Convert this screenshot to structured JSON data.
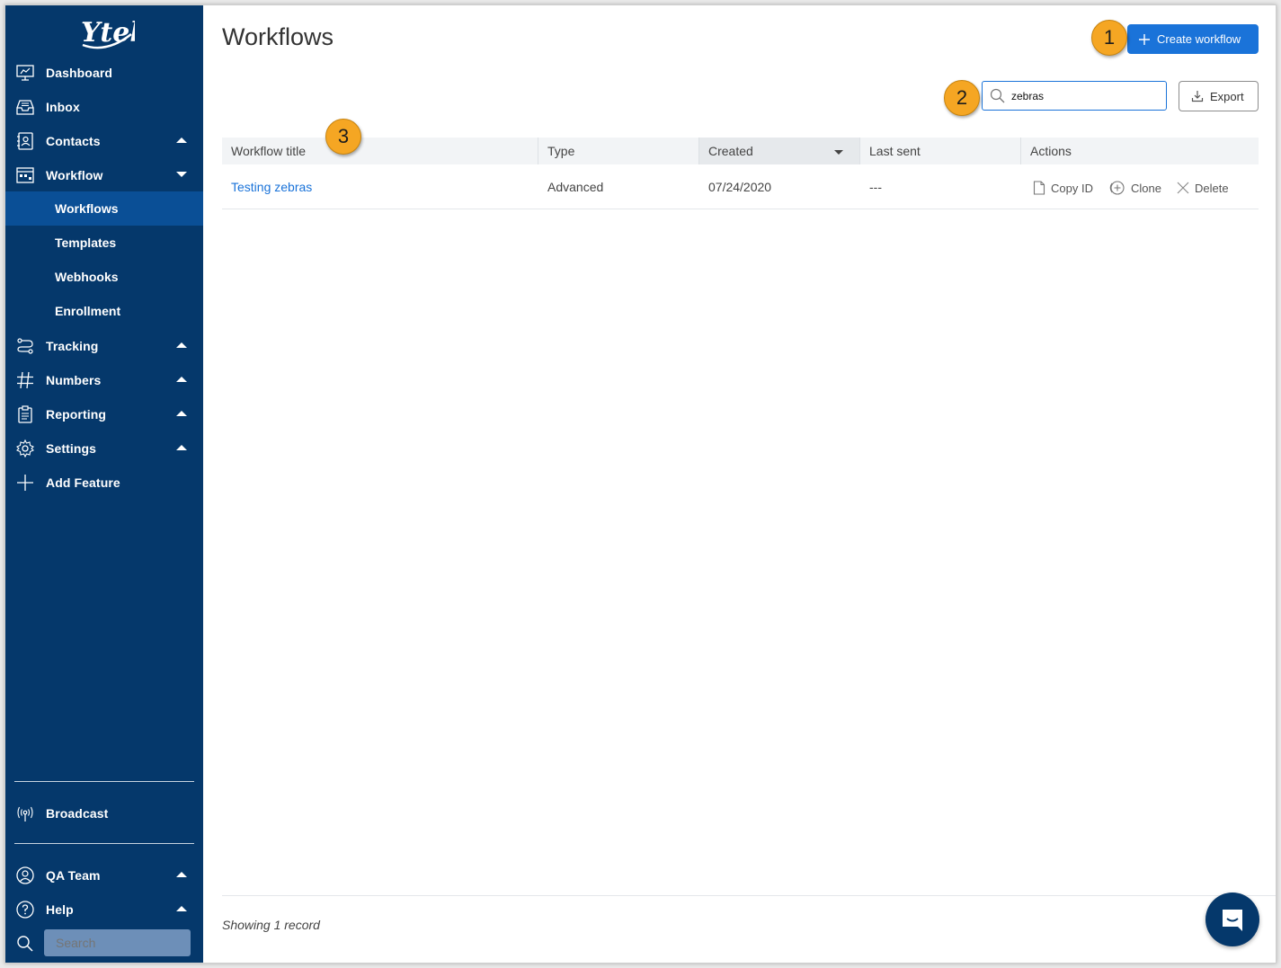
{
  "sidebar": {
    "logo_text": "Ytel",
    "items": [
      {
        "label": "Dashboard"
      },
      {
        "label": "Inbox"
      },
      {
        "label": "Contacts"
      },
      {
        "label": "Workflow"
      },
      {
        "label": "Tracking"
      },
      {
        "label": "Numbers"
      },
      {
        "label": "Reporting"
      },
      {
        "label": "Settings"
      },
      {
        "label": "Add Feature"
      }
    ],
    "workflow_sub": [
      {
        "label": "Workflows"
      },
      {
        "label": "Templates"
      },
      {
        "label": "Webhooks"
      },
      {
        "label": "Enrollment"
      }
    ],
    "broadcast": "Broadcast",
    "team": "QA Team",
    "help": "Help",
    "search_placeholder": "Search"
  },
  "header": {
    "title": "Workflows",
    "create_label": "Create workflow",
    "export_label": "Export",
    "search_value": "zebras"
  },
  "badges": [
    "1",
    "2",
    "3"
  ],
  "table": {
    "columns": [
      "Workflow title",
      "Type",
      "Created",
      "Last sent",
      "Actions"
    ],
    "rows": [
      {
        "title": "Testing zebras",
        "type": "Advanced",
        "created": "07/24/2020",
        "last_sent": "---"
      }
    ],
    "actions": {
      "copy": "Copy ID",
      "clone": "Clone",
      "delete": "Delete"
    }
  },
  "footer": {
    "text": "Showing 1 record"
  },
  "colors": {
    "sidebar": "#05386b",
    "active": "#0a4f96",
    "accent": "#1a73d9",
    "badge": "#f5a623"
  }
}
